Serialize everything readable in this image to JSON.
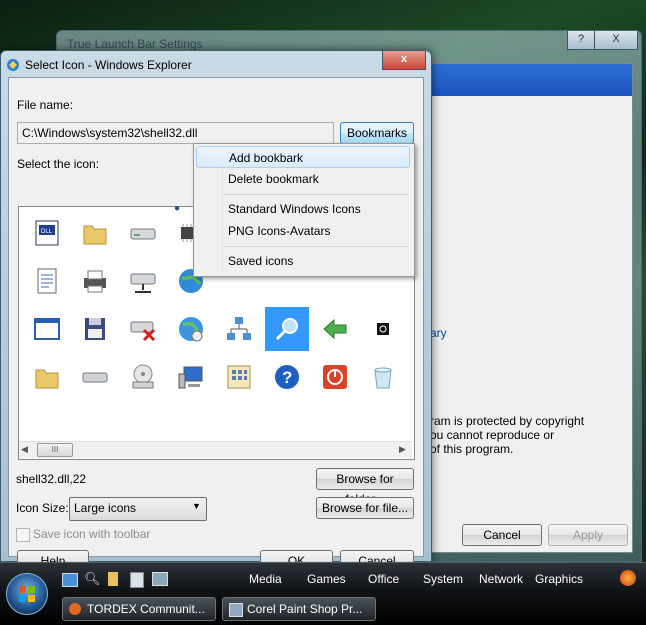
{
  "background_window": {
    "title": "True Launch Bar Settings",
    "help_btn": "?",
    "close_btn": "X",
    "text_fragment_1": "rary",
    "copyright_lines": [
      "ram is protected by copyright",
      "ou cannot reproduce or",
      "of this program."
    ],
    "cancel_label": "Cancel",
    "apply_label": "Apply"
  },
  "dialog": {
    "title": "Select Icon - Windows Explorer",
    "close_btn": "x",
    "file_name_label": "File name:",
    "file_name_value": "C:\\Windows\\system32\\shell32.dll",
    "bookmarks_label": "Bookmarks",
    "select_icon_label": "Select the icon:",
    "scroll_thumb": "III",
    "selected_icon_text": "shell32.dll,22",
    "browse_folder_label": "Browse for folder...",
    "browse_file_label": "Browse for file...",
    "icon_size_label": "Icon Size:",
    "icon_size_value": "Large icons",
    "save_toolbar_label": "Save icon with toolbar",
    "help_label": "Help",
    "ok_label": "OK",
    "cancel_label": "Cancel",
    "selected_index": 15
  },
  "bookmarks_menu": {
    "items": [
      "Add bookbark",
      "Delete bookmark",
      "Standard Windows Icons",
      "PNG Icons-Avatars",
      "Saved icons"
    ],
    "highlighted": 0,
    "checked": 2
  },
  "icons": [
    "dll-file-icon",
    "folder-icon",
    "drive-icon",
    "chip-icon",
    "",
    "document-icon",
    "printer-icon",
    "network-drive-icon",
    "globe-icon",
    "",
    "window-icon",
    "floppy-icon",
    "remove-drive-icon",
    "internet-icon",
    "network-icon",
    "search-icon",
    "back-arrow-icon",
    "small-badge-icon",
    "",
    "folder-icon",
    "cd-drive-icon",
    "dvd-drive-icon",
    "computer-icon",
    "control-panel-icon",
    "help-icon",
    "power-icon",
    "recycle-bin-icon"
  ],
  "taskbar": {
    "quicklaunch": [
      "Media",
      "Games",
      "Office",
      "System",
      "Network",
      "Graphics"
    ],
    "tasks": [
      "TORDEX Communit...",
      "Corel Paint Shop Pr..."
    ]
  },
  "colors": {
    "accent": "#3399ff",
    "titlebar": "#1a54c0",
    "close": "#c84536"
  }
}
